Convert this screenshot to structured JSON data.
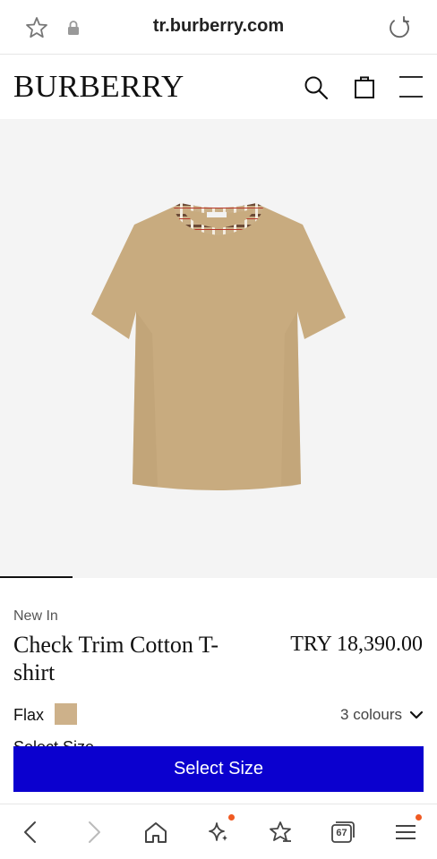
{
  "browser": {
    "url": "tr.burberry.com",
    "tab_count": "67",
    "icons": [
      "star-icon",
      "lock-icon",
      "reload-icon",
      "back-icon",
      "forward-icon",
      "home-icon",
      "sparkle-icon",
      "favorites-icon",
      "tabs-icon",
      "menu-icon"
    ],
    "accent_color": "#f05a22"
  },
  "header": {
    "logo": "BURBERRY",
    "icons": [
      "search-icon",
      "bag-icon",
      "menu-icon"
    ]
  },
  "product": {
    "badge": "New In",
    "title": "Check Trim Cotton T-shirt",
    "price": "TRY 18,390.00",
    "colour_name": "Flax",
    "colour_hex": "#cdb18a",
    "colours_label": "3 colours",
    "select_label": "Select Size",
    "cta_label": "Select Size",
    "cta_color": "#0b00cf"
  }
}
